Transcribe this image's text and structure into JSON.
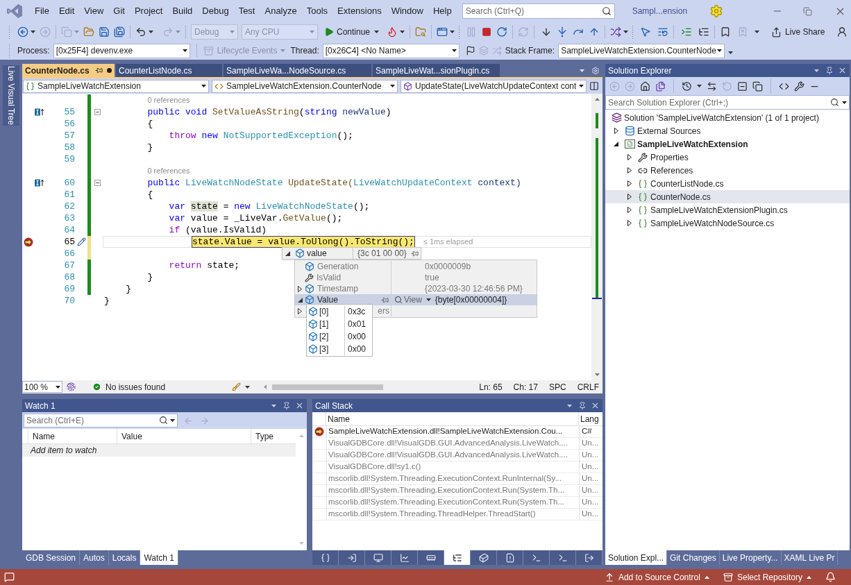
{
  "menu": [
    "File",
    "Edit",
    "View",
    "Git",
    "Project",
    "Build",
    "Debug",
    "Test",
    "Analyze",
    "Tools",
    "Extensions",
    "Window",
    "Help"
  ],
  "search": {
    "placeholder": "Search (Ctrl+Q)"
  },
  "window_title": "Sampl...ension",
  "toolbar": {
    "configuration": {
      "value": "Debug",
      "disabled": true
    },
    "platform": {
      "value": "Any CPU",
      "disabled": true
    },
    "continue": "Continue",
    "live_share": "Live Share"
  },
  "debug_location": {
    "process_label": "Process:",
    "process": "[0x25F4] devenv.exe",
    "lifecycle": "Lifecycle Events",
    "thread_label": "Thread:",
    "thread": "[0x26C4] <No Name>",
    "frame_label": "Stack Frame:",
    "frame": "SampleLiveWatchExtension.CounterNode"
  },
  "side_tab": "Live Visual Tree",
  "editor": {
    "tabs": [
      {
        "label": "CounterNode.cs",
        "selected": true,
        "modified": true
      },
      {
        "label": "CounterListNode.cs",
        "selected": false,
        "modified": false
      },
      {
        "label": "SampleLiveWa...NodeSource.cs",
        "selected": false,
        "modified": false
      },
      {
        "label": "SampleLiveWat...sionPlugin.cs",
        "selected": false,
        "modified": false
      }
    ],
    "nav": [
      "SampleLiveWatchExtension",
      "SampleLiveWatchExtension.CounterNode",
      "UpdateState(LiveWatchUpdateContext cont"
    ],
    "lines": [
      {
        "kind": "lens",
        "text": "0 references",
        "change_bar": {
          "color": "#1e8a1e"
        }
      },
      {
        "kind": "code",
        "number": "55",
        "lens_icon": true,
        "fold": true,
        "change_bar": {
          "color": "#1e8a1e"
        },
        "tokens": [
          {
            "text": "        public void",
            "color": "#0000ff"
          },
          {
            "text": " SetValueAsString",
            "color": "#74531f"
          },
          {
            "text": "(",
            "color": "#000000"
          },
          {
            "text": "string",
            "color": "#0000ff"
          },
          {
            "text": " newValue",
            "color": "#1f377f"
          },
          {
            "text": ")",
            "color": "#000000"
          }
        ]
      },
      {
        "kind": "code",
        "number": "56",
        "change_bar": {
          "color": "#1e8a1e"
        },
        "tokens": [
          {
            "text": "        {",
            "color": "#000000"
          }
        ]
      },
      {
        "kind": "code",
        "number": "57",
        "change_bar": {
          "color": "#1e8a1e"
        },
        "tokens": [
          {
            "text": "            throw",
            "color": "#8f08c4"
          },
          {
            "text": " new",
            "color": "#0000ff"
          },
          {
            "text": " NotSupportedException",
            "color": "#2b91af"
          },
          {
            "text": "();",
            "color": "#000000"
          }
        ]
      },
      {
        "kind": "code",
        "number": "58",
        "change_bar": {
          "color": "#1e8a1e"
        },
        "tokens": [
          {
            "text": "        }",
            "color": "#000000"
          }
        ]
      },
      {
        "kind": "code",
        "number": "59",
        "change_bar": {
          "color": "#1e8a1e"
        }
      },
      {
        "kind": "lens",
        "text": "0 references",
        "change_bar": {
          "color": "#1e8a1e"
        }
      },
      {
        "kind": "code",
        "number": "60",
        "lens_icon": true,
        "fold": true,
        "change_bar": {
          "color": "#1e8a1e"
        },
        "tokens": [
          {
            "text": "        public",
            "color": "#0000ff"
          },
          {
            "text": " LiveWatchNodeState",
            "color": "#2b91af"
          },
          {
            "text": " UpdateState(",
            "color": "#74531f"
          },
          {
            "text": "LiveWatchUpdateContext",
            "color": "#2b91af"
          },
          {
            "text": " context)",
            "color": "#1f377f"
          }
        ]
      },
      {
        "kind": "code",
        "number": "61",
        "change_bar": {
          "color": "#1e8a1e"
        },
        "tokens": [
          {
            "text": "        {",
            "color": "#000000"
          }
        ]
      },
      {
        "kind": "code",
        "number": "62",
        "change_bar": {
          "color": "#1e8a1e"
        },
        "tokens": [
          {
            "text": "            var ",
            "color": "#0000ff"
          },
          {
            "text": "state",
            "color": "#000000",
            "highlight": true
          },
          {
            "text": " = ",
            "color": "#000000"
          },
          {
            "text": "new",
            "color": "#0000ff"
          },
          {
            "text": " LiveWatchNodeState",
            "color": "#2b91af"
          },
          {
            "text": "();",
            "color": "#000000"
          }
        ]
      },
      {
        "kind": "code",
        "number": "63",
        "change_bar": {
          "color": "#1e8a1e"
        },
        "tokens": [
          {
            "text": "            var",
            "color": "#0000ff"
          },
          {
            "text": " value = _LiveVar.",
            "color": "#000000"
          },
          {
            "text": "GetValue",
            "color": "#74531f"
          },
          {
            "text": "();",
            "color": "#000000"
          }
        ]
      },
      {
        "kind": "code",
        "number": "64",
        "change_bar": {
          "color": "#1e8a1e"
        },
        "tokens": [
          {
            "text": "            if",
            "color": "#8f08c4"
          },
          {
            "text": " (value.IsValid)",
            "color": "#000000"
          }
        ]
      },
      {
        "kind": "code",
        "number": "65",
        "current": true,
        "change_bar": {
          "color": "#efe08e"
        },
        "statement": "state.Value = value.ToUlong().ToString();",
        "elapsed": "≤ 1ms elapsed"
      },
      {
        "kind": "code",
        "number": "66",
        "change_bar": {
          "color": "#efe08e"
        }
      },
      {
        "kind": "code",
        "number": "67",
        "change_bar": {
          "color": "#1e8a1e"
        },
        "tokens": [
          {
            "text": "            return",
            "color": "#8f08c4"
          },
          {
            "text": " state;",
            "color": "#000000"
          }
        ]
      },
      {
        "kind": "code",
        "number": "68",
        "change_bar": {
          "color": "#1e8a1e"
        },
        "tokens": [
          {
            "text": "        }",
            "color": "#000000"
          }
        ]
      },
      {
        "kind": "code",
        "number": "69",
        "change_bar": {
          "color": "#1e8a1e"
        },
        "tokens": [
          {
            "text": "    }",
            "color": "#000000"
          }
        ]
      },
      {
        "kind": "code",
        "number": "70",
        "tokens": [
          {
            "text": "}",
            "color": "#000000"
          }
        ]
      }
    ],
    "zoom": "100 %",
    "issues": "No issues found",
    "position": [
      "Ln: 65",
      "Ch: 17",
      "SPC",
      "CRLF"
    ]
  },
  "datatip": {
    "name": "value",
    "value": "{3c 01 00 00}",
    "expanded": true,
    "children": [
      {
        "name": "Generation",
        "value": "0x0000009b",
        "kind": "field",
        "selected": false
      },
      {
        "name": "IsValid",
        "value": "true",
        "kind": "property",
        "selected": false
      },
      {
        "name": "Timestamp",
        "value": "{2023-03-30 12:46:56 PM}",
        "kind": "field",
        "expanded": false,
        "selected": false
      },
      {
        "name": "Value",
        "value": "{byte[0x00000004]}",
        "kind": "field",
        "expanded": true,
        "selected": true,
        "visualizer": "View",
        "items": [
          {
            "name": "[0]",
            "value": "0x3c"
          },
          {
            "name": "[1]",
            "value": "0x01"
          },
          {
            "name": "[2]",
            "value": "0x00"
          },
          {
            "name": "[3]",
            "value": "0x00"
          }
        ]
      },
      {
        "name": "ers",
        "expanded": false,
        "selected": false,
        "covered": true
      }
    ]
  },
  "solution_explorer": {
    "title": "Solution Explorer",
    "search": {
      "placeholder": "Search Solution Explorer (Ctrl+;)"
    },
    "tree": [
      {
        "label": "Solution 'SampleLiveWatchExtension' (1 of 1 project)",
        "kind": "solution",
        "selected": false,
        "children": [
          {
            "label": "External Sources",
            "kind": "external",
            "expanded": false,
            "selected": false
          },
          {
            "label": "SampleLiveWatchExtension",
            "kind": "project",
            "expanded": true,
            "selected": false,
            "children": [
              {
                "label": "Properties",
                "kind": "properties",
                "expanded": false,
                "selected": false
              },
              {
                "label": "References",
                "kind": "references",
                "expanded": false,
                "selected": false
              },
              {
                "label": "CounterListNode.cs",
                "kind": "csharp",
                "expanded": false,
                "selected": false
              },
              {
                "label": "CounterNode.cs",
                "kind": "csharp",
                "expanded": false,
                "selected": true
              },
              {
                "label": "SampleLiveWatchExtensionPlugin.cs",
                "kind": "csharp",
                "expanded": false,
                "selected": false
              },
              {
                "label": "SampleLiveWatchNodeSource.cs",
                "kind": "csharp",
                "expanded": false,
                "selected": false
              }
            ]
          }
        ]
      }
    ],
    "tabs": [
      {
        "label": "Solution Expl...",
        "selected": true
      },
      {
        "label": "Git Changes",
        "selected": false
      },
      {
        "label": "Live Property...",
        "selected": false
      },
      {
        "label": "XAML Live Pr",
        "selected": false
      }
    ]
  },
  "watch": {
    "title": "Watch 1",
    "search": {
      "placeholder": "Search (Ctrl+E)"
    },
    "columns": [
      "Name",
      "Value",
      "Type"
    ],
    "placeholder_row": "Add item to watch",
    "tabs": [
      {
        "label": "GDB Session",
        "selected": false
      },
      {
        "label": "Autos",
        "selected": false
      },
      {
        "label": "Locals",
        "selected": false
      },
      {
        "label": "Watch 1",
        "selected": true
      }
    ]
  },
  "call_stack": {
    "title": "Call Stack",
    "columns": [
      "Name",
      "Lang"
    ],
    "rows": [
      {
        "name": "SampleLiveWatchExtension.dll!SampleLiveWatchExtension.Cou...",
        "lang": "C#",
        "current": true
      },
      {
        "name": "VisualGDBCore.dll!VisualGDB.GUI.AdvancedAnalysis.LiveWatch....",
        "lang": "Un...",
        "current": false
      },
      {
        "name": "VisualGDBCore.dll!VisualGDB.GUI.AdvancedAnalysis.LiveWatch....",
        "lang": "Un...",
        "current": false
      },
      {
        "name": "VisualGDBCore.dll!sy1.c()",
        "lang": "Un...",
        "current": false
      },
      {
        "name": "mscorlib.dll!System.Threading.ExecutionContext.RunInternal(Sy...",
        "lang": "Un...",
        "current": false
      },
      {
        "name": "mscorlib.dll!System.Threading.ExecutionContext.Run(System.Th...",
        "lang": "Un...",
        "current": false
      },
      {
        "name": "mscorlib.dll!System.Threading.ExecutionContext.Run(System.Th...",
        "lang": "Un...",
        "current": false
      },
      {
        "name": "mscorlib.dll!System.Threading.ThreadHelper.ThreadStart()",
        "lang": "Un...",
        "current": false
      }
    ],
    "tool_tabs": [
      {
        "selected": false
      },
      {
        "selected": false
      },
      {
        "selected": false
      },
      {
        "selected": false
      },
      {
        "selected": false
      },
      {
        "selected": true
      },
      {
        "selected": false
      },
      {
        "selected": false
      },
      {
        "selected": false
      },
      {
        "selected": false
      },
      {
        "selected": false
      }
    ]
  },
  "status_bar": {
    "source_control": "Add to Source Control",
    "repository": "Select Repository"
  }
}
